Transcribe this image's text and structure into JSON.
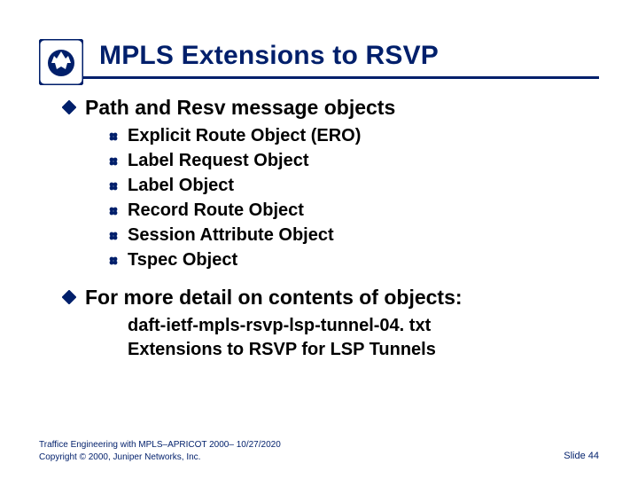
{
  "colors": {
    "brand": "#001f6b"
  },
  "title": "MPLS Extensions to RSVP",
  "bullets": {
    "top1": "Path and Resv message objects",
    "sub": [
      "Explicit Route Object (ERO)",
      "Label Request Object",
      "Label Object",
      "Record Route Object",
      "Session Attribute Object",
      "Tspec Object"
    ],
    "top2": "For more detail on contents of objects:",
    "refs": [
      "daft-ietf-mpls-rsvp-lsp-tunnel-04. txt",
      "Extensions to RSVP for LSP Tunnels"
    ]
  },
  "footer": {
    "left_line1": "Traffice Engineering with MPLS–APRICOT 2000– 10/27/2020",
    "left_line2": "Copyright © 2000, Juniper Networks, Inc.",
    "right": "Slide 44"
  }
}
